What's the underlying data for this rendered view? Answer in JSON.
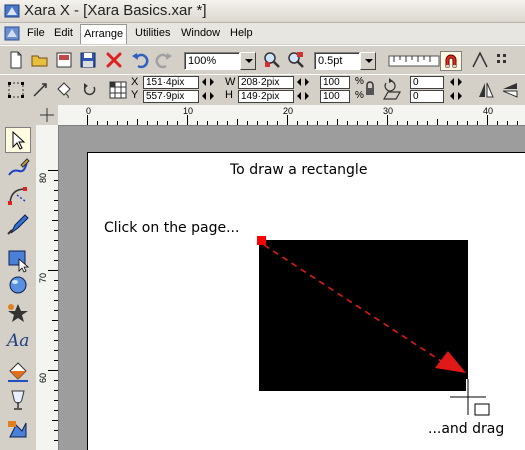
{
  "window": {
    "title": "Xara X - [Xara Basics.xar *]"
  },
  "menu": {
    "items": [
      {
        "label": "File"
      },
      {
        "label": "Edit"
      },
      {
        "label": "Arrange"
      },
      {
        "label": "Utilities"
      },
      {
        "label": "Window"
      },
      {
        "label": "Help"
      }
    ],
    "active_index": 2
  },
  "toolbar": {
    "zoom_value": "100%",
    "line_width_value": "0.5pt"
  },
  "infobar": {
    "x_value": "151·4pix",
    "y_value": "557·9pix",
    "w_label": "W",
    "h_label": "H",
    "w_value": "208·2pix",
    "h_value": "149·2pix",
    "x_label": "X",
    "y_label": "Y",
    "scale_w": "100",
    "scale_h": "100",
    "percent_sign": "%",
    "angle_value": "0",
    "skew_value": "0"
  },
  "ruler": {
    "h_ticks": [
      "0",
      "10",
      "20",
      "30",
      "40"
    ],
    "v_ticks": [
      "80",
      "70",
      "60"
    ]
  },
  "page": {
    "heading": "To draw a rectangle",
    "instruction": "Click on the page...",
    "drag_hint": "...and drag"
  },
  "colors": {
    "rectangle_fill": "#000000",
    "arrow": "#e01818",
    "start_marker": "#ff0000",
    "menu_active_bg": "#ffffff"
  },
  "icons": {
    "tools": [
      "selector-tool-icon",
      "freehand-tool-icon",
      "bezier-tool-icon",
      "pen-tool-icon",
      "rectangle-tool-icon",
      "ellipse-tool-icon",
      "quickshape-tool-icon",
      "text-tool-icon",
      "fill-tool-icon",
      "transparency-tool-icon",
      "mould-tool-icon"
    ]
  }
}
